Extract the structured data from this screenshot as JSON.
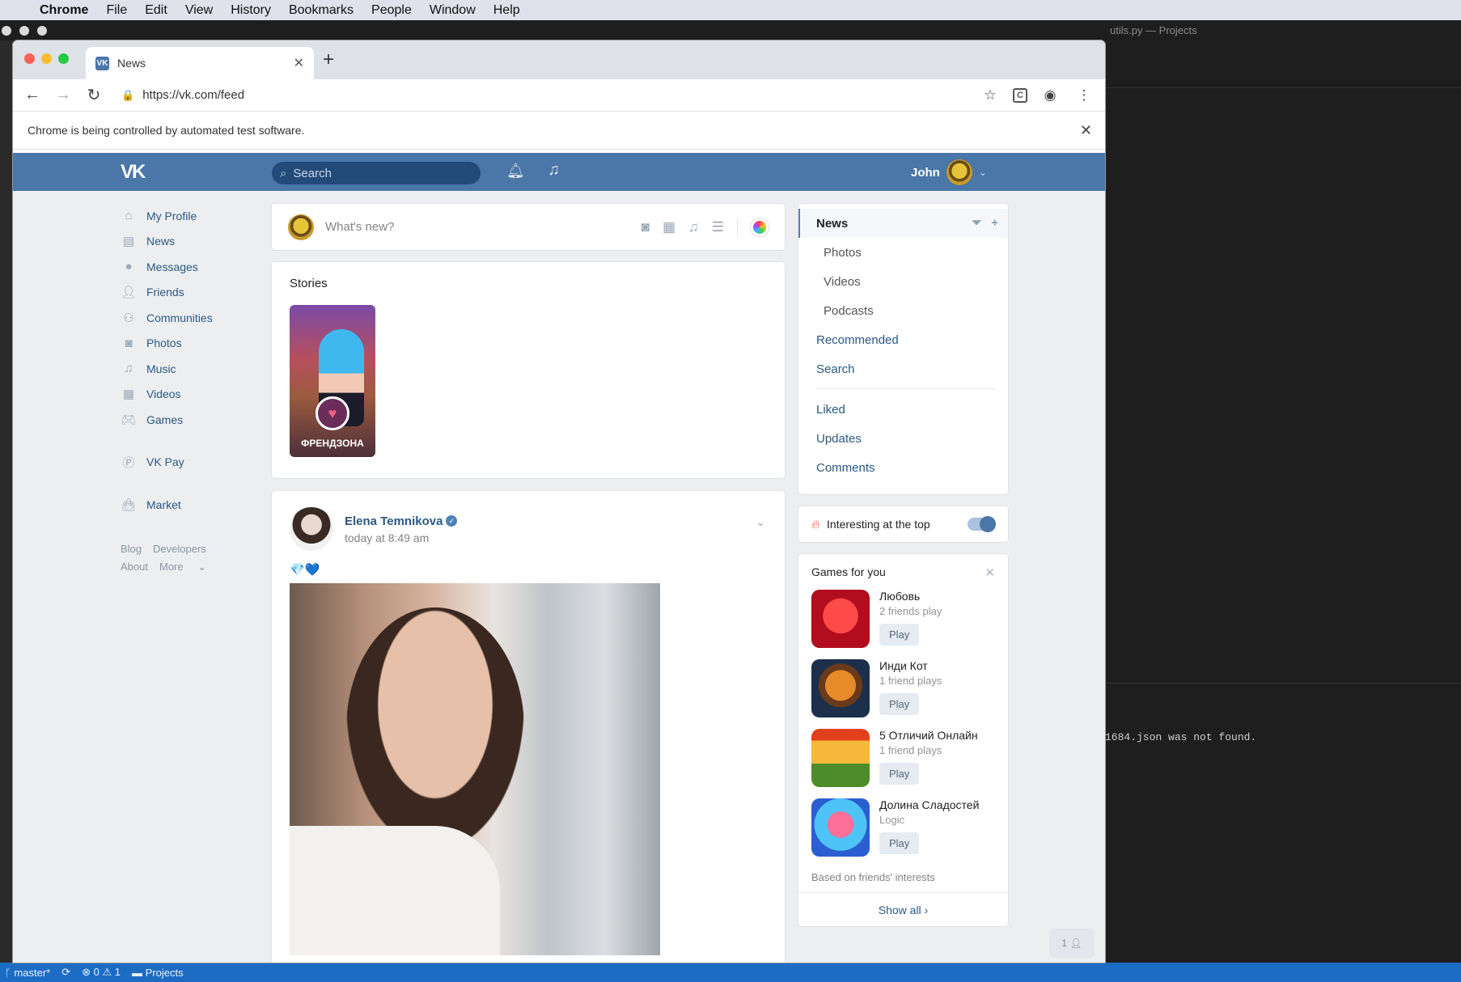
{
  "macos_menu": {
    "apple": "",
    "app": "Chrome",
    "items": [
      "File",
      "Edit",
      "View",
      "History",
      "Bookmarks",
      "People",
      "Window",
      "Help"
    ]
  },
  "editor": {
    "title": "utils.py — Projects",
    "log_line": "1684.json was not found."
  },
  "statusbar": {
    "branch": "master*",
    "errors": "0",
    "warnings": "1",
    "folder": "Projects"
  },
  "browser": {
    "tab_title": "News",
    "tab_favicon": "VK",
    "url": "https://vk.com/feed",
    "infobar_text": "Chrome is being controlled by automated test software."
  },
  "vk": {
    "logo": "VK",
    "search_placeholder": "Search",
    "username": "John",
    "left_nav": [
      "My Profile",
      "News",
      "Messages",
      "Friends",
      "Communities",
      "Photos",
      "Music",
      "Videos",
      "Games"
    ],
    "left_nav_extra": [
      "VK Pay",
      "Market"
    ],
    "footer_links": [
      "Blog",
      "Developers",
      "About",
      "More"
    ],
    "compose_placeholder": "What's new?",
    "stories_title": "Stories",
    "story_label": "ФРЕНДЗОНА",
    "post": {
      "author": "Elena Temnikova",
      "time": "today at 8:49 am",
      "text": "💎💙"
    },
    "right_nav": {
      "selected": "News",
      "sub": [
        "Photos",
        "Videos",
        "Podcasts"
      ],
      "main": [
        "Recommended",
        "Search"
      ],
      "after_divider": [
        "Liked",
        "Updates",
        "Comments"
      ]
    },
    "interesting_label": "Interesting at the top",
    "interesting_on": true,
    "games": {
      "title": "Games for you",
      "items": [
        {
          "name": "Любовь",
          "sub": "2 friends play",
          "play": "Play"
        },
        {
          "name": "Инди Кот",
          "sub": "1 friend plays",
          "play": "Play"
        },
        {
          "name": "5 Отличий Онлайн",
          "sub": "1 friend plays",
          "play": "Play"
        },
        {
          "name": "Долина Сладостей",
          "sub": "Logic",
          "play": "Play"
        }
      ],
      "basis": "Based on friends' interests",
      "show_all": "Show all"
    },
    "chat_counter": "1"
  },
  "colors": {
    "vk_blue": "#4a76a8",
    "vk_link": "#2a5885",
    "page_bg": "#edeef0",
    "statusbar": "#1c6cc4"
  }
}
